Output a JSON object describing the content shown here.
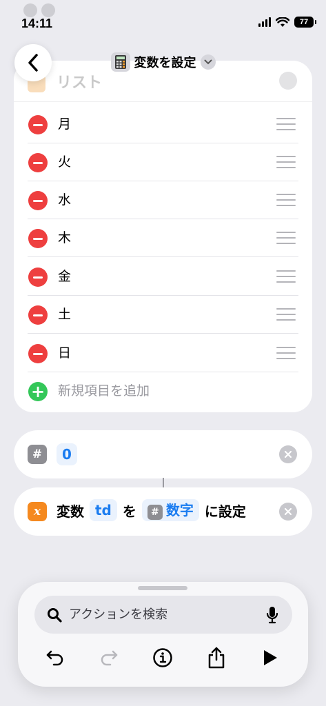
{
  "status": {
    "time": "14:11",
    "battery": "77"
  },
  "header": {
    "title": "変数を設定",
    "title_icon": "calculator-icon"
  },
  "list_action": {
    "header_label": "リスト",
    "items": [
      {
        "label": "月"
      },
      {
        "label": "火"
      },
      {
        "label": "水"
      },
      {
        "label": "木"
      },
      {
        "label": "金"
      },
      {
        "label": "土"
      },
      {
        "label": "日"
      }
    ],
    "add_label": "新規項目を追加"
  },
  "number_action": {
    "icon_text": "#",
    "value": "0"
  },
  "set_variable_action": {
    "icon_text": "x",
    "prefix": "変数",
    "variable_name": "td",
    "particle": "を",
    "input_icon_text": "#",
    "input_token": "数字",
    "suffix": "に設定"
  },
  "bottom_panel": {
    "search_placeholder": "アクションを検索"
  },
  "colors": {
    "accent": "#1a7cf0",
    "remove": "#ee3f3f",
    "add": "#34c759",
    "variable_icon": "#f5891f",
    "number_icon": "#8e8e93"
  }
}
